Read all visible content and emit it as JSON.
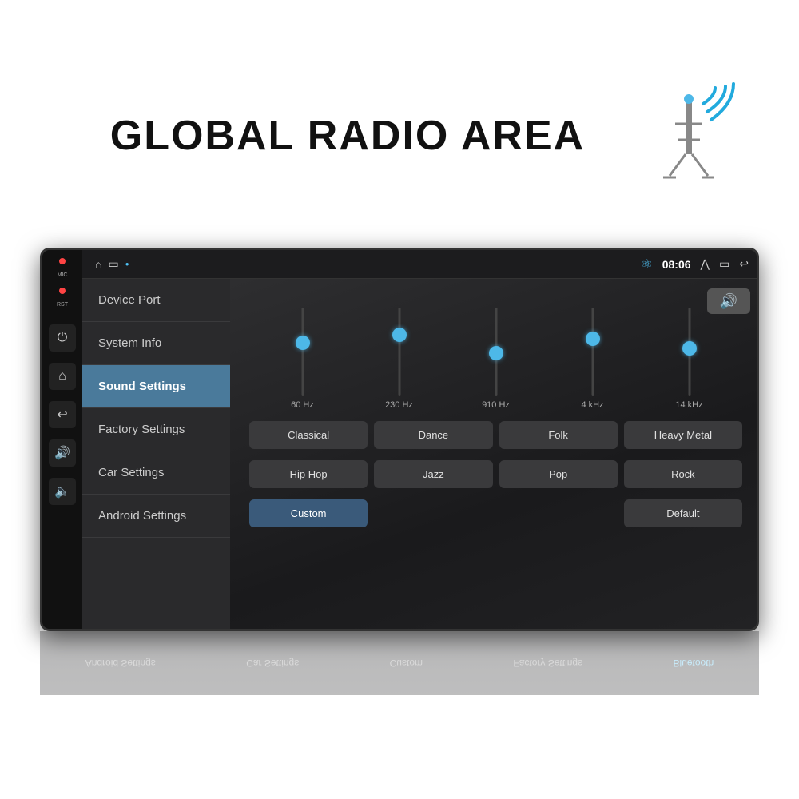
{
  "header": {
    "title": "GLOBAL RADIO AREA"
  },
  "statusBar": {
    "time": "08:06",
    "icons": [
      "home",
      "apps",
      "bluetooth"
    ]
  },
  "navMenu": {
    "items": [
      {
        "id": "device-port",
        "label": "Device Port",
        "active": false
      },
      {
        "id": "system-info",
        "label": "System Info",
        "active": false
      },
      {
        "id": "sound-settings",
        "label": "Sound Settings",
        "active": true
      },
      {
        "id": "factory-settings",
        "label": "Factory Settings",
        "active": false
      },
      {
        "id": "car-settings",
        "label": "Car Settings",
        "active": false
      },
      {
        "id": "android-settings",
        "label": "Android Settings",
        "active": false
      }
    ]
  },
  "soundPanel": {
    "eqBands": [
      {
        "freq": "60 Hz",
        "position": 40
      },
      {
        "freq": "230 Hz",
        "position": 30
      },
      {
        "freq": "910 Hz",
        "position": 50
      },
      {
        "freq": "4 kHz",
        "position": 35
      },
      {
        "freq": "14 kHz",
        "position": 45
      }
    ],
    "presets": [
      {
        "id": "classical",
        "label": "Classical"
      },
      {
        "id": "dance",
        "label": "Dance"
      },
      {
        "id": "folk",
        "label": "Folk"
      },
      {
        "id": "heavy-metal",
        "label": "Heavy Metal"
      },
      {
        "id": "hip-hop",
        "label": "Hip Hop"
      },
      {
        "id": "jazz",
        "label": "Jazz"
      },
      {
        "id": "pop",
        "label": "Pop"
      },
      {
        "id": "rock",
        "label": "Rock"
      }
    ],
    "customLabel": "Custom",
    "defaultLabel": "Default"
  },
  "sideButtons": {
    "mic": "MIC",
    "rst": "RST",
    "icons": [
      "⏻",
      "⌂",
      "↩",
      "🔊",
      "🔈"
    ]
  },
  "reflection": {
    "items": [
      "Android Settings",
      "Car Settings",
      "Custom",
      "Factory Settings",
      "Bluetooth"
    ]
  }
}
